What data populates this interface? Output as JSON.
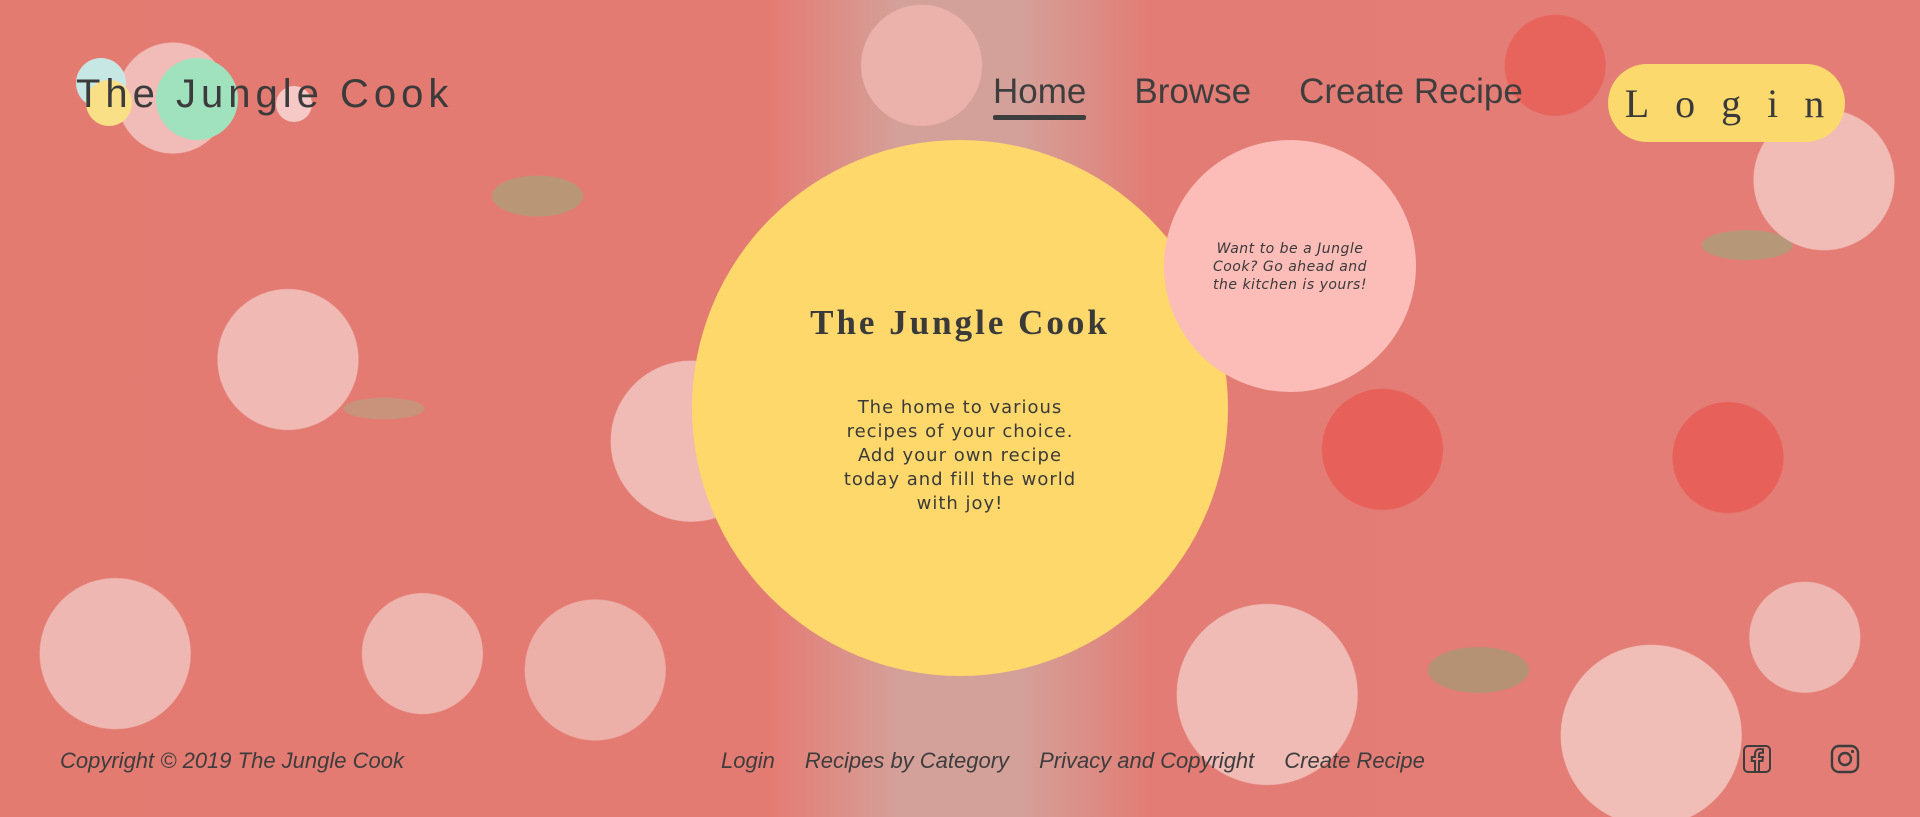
{
  "brand": {
    "logo_text": "The Jungle Cook"
  },
  "nav": {
    "items": [
      {
        "label": "Home",
        "active": true
      },
      {
        "label": "Browse",
        "active": false
      },
      {
        "label": "Create Recipe",
        "active": false
      }
    ],
    "login_label": "Login"
  },
  "hero": {
    "title": "The Jungle Cook",
    "text": "The home to various recipes of your choice. Add your own recipe today and fill the world with joy!"
  },
  "promo": {
    "text": "Want to be a Jungle Cook? Go ahead and the kitchen is yours!"
  },
  "footer": {
    "copyright": "Copyright © 2019 The Jungle Cook",
    "links": [
      "Login",
      "Recipes by Category",
      "Privacy and Copyright",
      "Create Recipe"
    ],
    "social": [
      "facebook-icon",
      "instagram-icon"
    ]
  },
  "colors": {
    "accent_yellow": "#fed86b",
    "accent_pink": "#fcbcb7",
    "logo_mint": "#9fe2bd",
    "text_dark": "#3a3a3a"
  }
}
